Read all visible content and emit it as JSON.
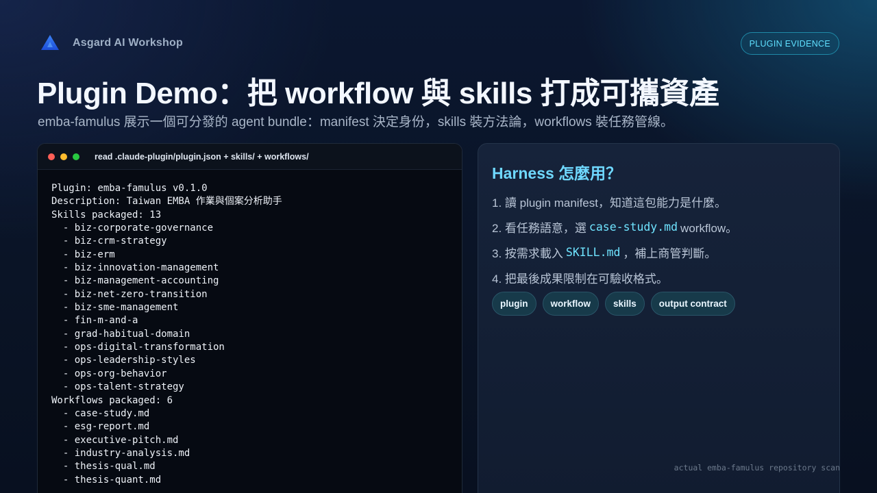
{
  "header": {
    "brand_name": "Asgard AI Workshop",
    "logo_icon": "triangle-logo-icon",
    "badge": "PLUGIN EVIDENCE"
  },
  "slide": {
    "title": "Plugin Demo：把 workflow 與 skills 打成可攜資產",
    "subtitle": "emba-famulus 展示一個可分發的 agent bundle：manifest 決定身份，skills 裝方法論，workflows 裝任務管線。"
  },
  "terminal": {
    "title": "read .claude-plugin/plugin.json + skills/ + workflows/",
    "lines": [
      "Plugin: emba-famulus v0.1.0",
      "Description: Taiwan EMBA 作業與個案分析助手",
      "Skills packaged: 13",
      "  - biz-corporate-governance",
      "  - biz-crm-strategy",
      "  - biz-erm",
      "  - biz-innovation-management",
      "  - biz-management-accounting",
      "  - biz-net-zero-transition",
      "  - biz-sme-management",
      "  - fin-m-and-a",
      "  - grad-habitual-domain",
      "  - ops-digital-transformation",
      "  - ops-leadership-styles",
      "  - ops-org-behavior",
      "  - ops-talent-strategy",
      "Workflows packaged: 6",
      "  - case-study.md",
      "  - esg-report.md",
      "  - executive-pitch.md",
      "  - industry-analysis.md",
      "  - thesis-qual.md",
      "  - thesis-quant.md"
    ]
  },
  "panel": {
    "title": "Harness 怎麼用？",
    "steps": [
      {
        "pre": "1. 讀 plugin manifest，知道這包能力是什麼。",
        "code": "",
        "post": ""
      },
      {
        "pre": "2. 看任務語意，選",
        "code": "case-study.md",
        "post": "workflow。"
      },
      {
        "pre": "3. 按需求載入",
        "code": "SKILL.md",
        "post": "，補上商管判斷。"
      },
      {
        "pre": "4. 把最後成果限制在可驗收格式。",
        "code": "",
        "post": ""
      }
    ],
    "tags": [
      "plugin",
      "workflow",
      "skills",
      "output contract"
    ]
  },
  "footnote": "actual emba-famulus repository scan"
}
